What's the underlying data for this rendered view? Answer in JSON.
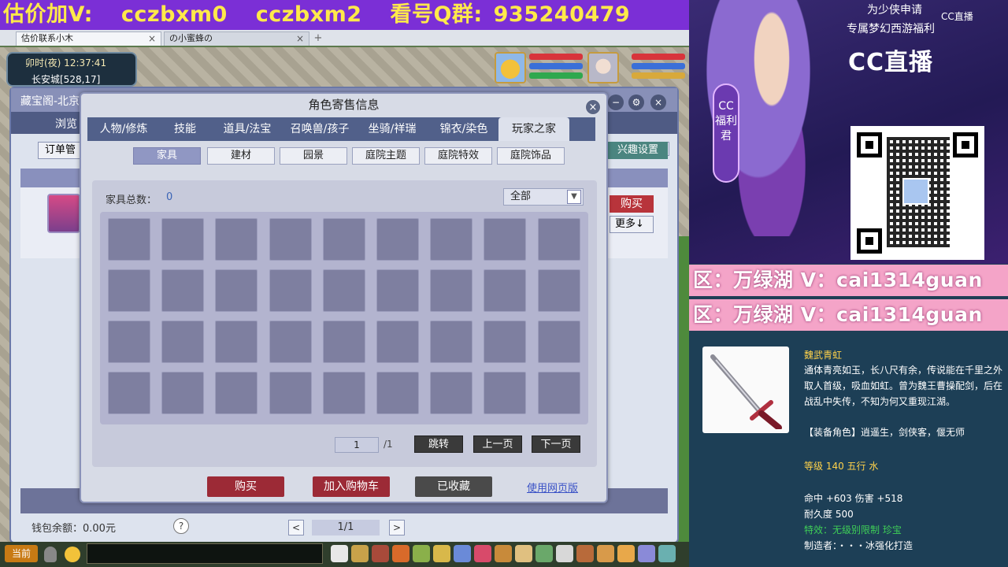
{
  "banner": {
    "items": [
      "估价加V:",
      "cczbxm0",
      "cczbxm2",
      "看号Q群:",
      "935240479"
    ]
  },
  "browser": {
    "tabs": [
      {
        "label": "估价联系小木",
        "close": "×"
      },
      {
        "label": "の小蜜蜂の",
        "close": "×"
      }
    ],
    "add": "+"
  },
  "hud": {
    "time": "卯时(夜)  12:37:41",
    "location": "长安城[528,17]"
  },
  "shop": {
    "title": "藏宝阁-北京",
    "tab": "浏览",
    "orders": "订单管",
    "interest": "兴趣设置",
    "buy": "购买",
    "more": "更多↓",
    "wallet": "钱包余额：0.00元",
    "help": "?",
    "prev": "<",
    "next": ">",
    "page": "1/1",
    "win_min": "−",
    "win_gear": "⚙",
    "win_close": "×"
  },
  "dialog": {
    "title": "角色寄售信息",
    "close": "×",
    "tabs": [
      "人物/修炼",
      "技能",
      "道具/法宝",
      "召唤兽/孩子",
      "坐骑/祥瑞",
      "锦衣/染色",
      "玩家之家"
    ],
    "active_tab": 6,
    "subtabs": [
      "家具",
      "建材",
      "园景",
      "庭院主题",
      "庭院特效",
      "庭院饰品"
    ],
    "active_subtab": 0,
    "count_label": "家具总数：",
    "count_value": "0",
    "filter": "全部",
    "filter_arrow": "▼",
    "grid": {
      "rows": 4,
      "cols": 9
    },
    "page_input": "1",
    "page_total": "/1",
    "jump": "跳转",
    "prev_page": "上一页",
    "next_page": "下一页",
    "buy": "购买",
    "cart": "加入购物车",
    "saved": "已收藏",
    "web_link": "使用网页版"
  },
  "chat": {
    "current": "当前"
  },
  "promo": {
    "line1": "为少侠申请",
    "line2": "专属梦幻西游福利",
    "cc_small": "CC直播",
    "cc_logo": "CC直播",
    "welfare": "CC福利君"
  },
  "ads": {
    "line1": "区：万绿湖 V：cai1314guan",
    "line2": "区：万绿湖 V：cai1314guan"
  },
  "item": {
    "name": "魏武青虹",
    "desc": "通体青亮如玉，长八尺有余，传说能在千里之外取人首级，吸血如虹。曾为魏王曹操配剑，后在战乱中失传，不知为何又重现江湖。",
    "role": "【装备角色】逍遥生，剑侠客，偃无师",
    "level": "等级 140  五行 水",
    "stats": "命中 +603  伤害 +518",
    "durability": "耐久度 500",
    "effect": "特效：无级别限制  珍宝",
    "maker": "制造者：・・・冰强化打造"
  },
  "colors": {
    "banner_bg": "#7b2fd6",
    "banner_text": "#ffe94a",
    "ad_bg": "#f4a4c8",
    "dialog_tab_bar": "#51608a",
    "buy_red": "#b8343b",
    "item_name": "#ffd24a",
    "item_effect": "#3fcf57"
  }
}
